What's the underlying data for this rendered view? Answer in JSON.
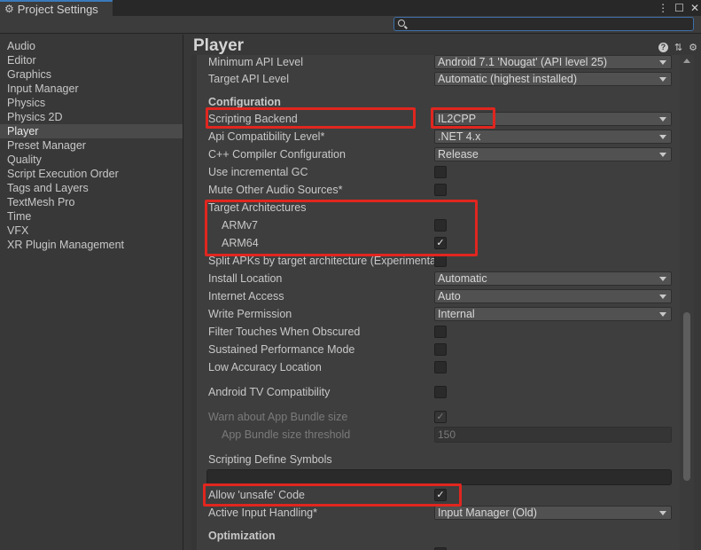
{
  "window": {
    "title": "Project Settings",
    "controls": [
      "⋮",
      "☐",
      "✕"
    ]
  },
  "search": {
    "placeholder": "",
    "value": ""
  },
  "sidebar": {
    "items": [
      {
        "label": "Audio"
      },
      {
        "label": "Editor"
      },
      {
        "label": "Graphics"
      },
      {
        "label": "Input Manager"
      },
      {
        "label": "Physics"
      },
      {
        "label": "Physics 2D"
      },
      {
        "label": "Player",
        "active": true
      },
      {
        "label": "Preset Manager"
      },
      {
        "label": "Quality"
      },
      {
        "label": "Script Execution Order"
      },
      {
        "label": "Tags and Layers"
      },
      {
        "label": "TextMesh Pro"
      },
      {
        "label": "Time"
      },
      {
        "label": "VFX"
      },
      {
        "label": "XR Plugin Management"
      }
    ]
  },
  "main": {
    "title": "Player",
    "header_icons": [
      "help-icon",
      "sliders-icon",
      "gear-icon"
    ],
    "rows": {
      "min_api": {
        "label": "Minimum API Level",
        "value": "Android 7.1 'Nougat' (API level 25)"
      },
      "target_api": {
        "label": "Target API Level",
        "value": "Automatic (highest installed)"
      },
      "configuration": "Configuration",
      "scripting_backend": {
        "label": "Scripting Backend",
        "value": "IL2CPP"
      },
      "api_compat": {
        "label": "Api Compatibility Level*",
        "value": ".NET 4.x"
      },
      "cpp_config": {
        "label": "C++ Compiler Configuration",
        "value": "Release"
      },
      "incremental_gc": {
        "label": "Use incremental GC",
        "checked": false
      },
      "mute_audio": {
        "label": "Mute Other Audio Sources*",
        "checked": false
      },
      "target_arch": "Target Architectures",
      "armv7": {
        "label": "ARMv7",
        "checked": false
      },
      "arm64": {
        "label": "ARM64",
        "checked": true
      },
      "split_apks": {
        "label": "Split APKs by target architecture (Experimenta",
        "checked": false
      },
      "install_location": {
        "label": "Install Location",
        "value": "Automatic"
      },
      "internet_access": {
        "label": "Internet Access",
        "value": "Auto"
      },
      "write_permission": {
        "label": "Write Permission",
        "value": "Internal"
      },
      "filter_touches": {
        "label": "Filter Touches When Obscured",
        "checked": false
      },
      "sustained_perf": {
        "label": "Sustained Performance Mode",
        "checked": false
      },
      "low_accuracy": {
        "label": "Low Accuracy Location",
        "checked": false
      },
      "android_tv": {
        "label": "Android TV Compatibility",
        "checked": false
      },
      "warn_bundle": {
        "label": "Warn about App Bundle size",
        "checked": true
      },
      "bundle_threshold": {
        "label": "App Bundle size threshold",
        "value": "150"
      },
      "define_symbols": {
        "label": "Scripting Define Symbols",
        "value": ""
      },
      "allow_unsafe": {
        "label": "Allow 'unsafe' Code",
        "checked": true
      },
      "input_handling": {
        "label": "Active Input Handling*",
        "value": "Input Manager (Old)"
      },
      "optimization": "Optimization"
    }
  },
  "colors": {
    "highlight": "#e0261f",
    "accent": "#3a79bb",
    "panel_bg": "#3e3e3e",
    "window_bg": "#383838"
  }
}
